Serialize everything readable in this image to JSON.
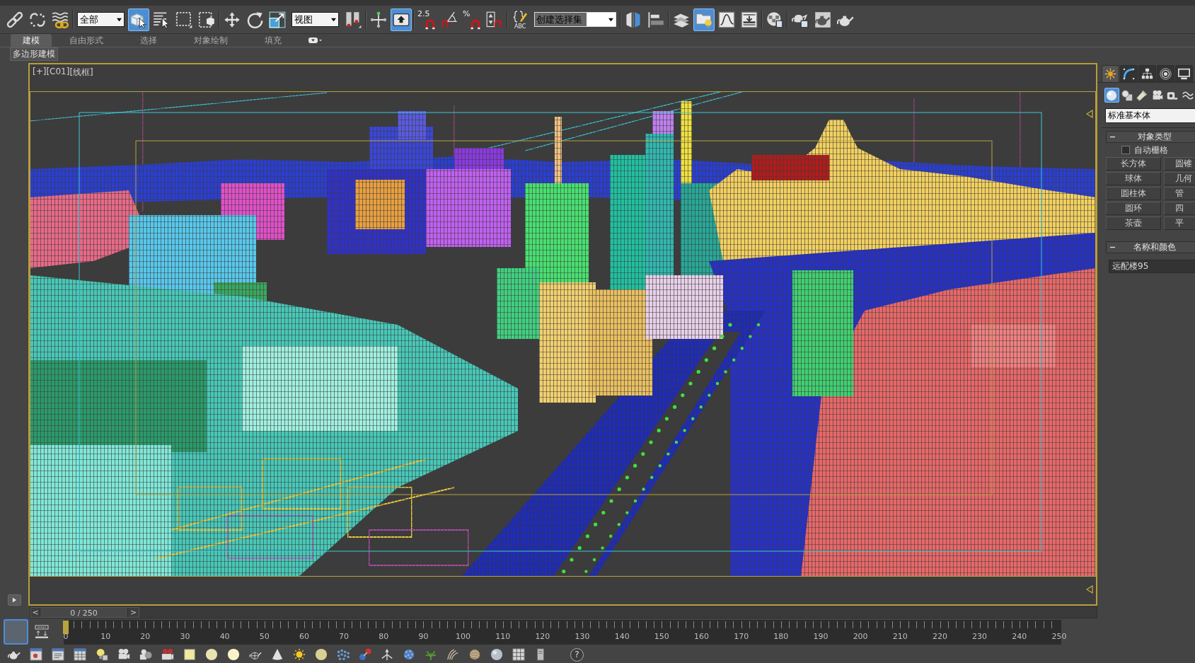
{
  "main_toolbar": [
    {
      "kind": "button",
      "active": false
    },
    {
      "kind": "button",
      "active": false
    },
    {
      "kind": "button",
      "active": false
    },
    {
      "kind": "separator"
    },
    {
      "kind": "dropdown",
      "value": "全部"
    },
    {
      "kind": "button",
      "active": true
    },
    {
      "kind": "button",
      "active": false
    },
    {
      "kind": "button",
      "active": false
    },
    {
      "kind": "button",
      "active": false
    },
    {
      "kind": "separator"
    },
    {
      "kind": "button",
      "active": false
    },
    {
      "kind": "button",
      "active": false
    },
    {
      "kind": "button",
      "active": false
    },
    {
      "kind": "dropdown",
      "value": "视图"
    },
    {
      "kind": "button",
      "active": false
    },
    {
      "kind": "separator"
    },
    {
      "kind": "button",
      "active": false
    },
    {
      "kind": "button",
      "active": true
    },
    {
      "kind": "separator"
    },
    {
      "kind": "snap",
      "label": "2.5",
      "active": false
    },
    {
      "kind": "button",
      "active": false
    },
    {
      "kind": "snap",
      "label": "%",
      "active": false
    },
    {
      "kind": "button",
      "active": false
    },
    {
      "kind": "separator"
    },
    {
      "kind": "captioned",
      "label": "ABC",
      "active": false
    },
    {
      "kind": "combo",
      "value": "创建选择集"
    },
    {
      "kind": "separator"
    },
    {
      "kind": "button",
      "active": false
    },
    {
      "kind": "button",
      "active": false
    },
    {
      "kind": "separator"
    },
    {
      "kind": "button",
      "active": false
    },
    {
      "kind": "button",
      "active": true
    },
    {
      "kind": "button",
      "active": false
    },
    {
      "kind": "button",
      "active": false
    },
    {
      "kind": "separator"
    },
    {
      "kind": "button",
      "active": false
    },
    {
      "kind": "separator"
    },
    {
      "kind": "button",
      "active": false
    },
    {
      "kind": "button",
      "active": false
    },
    {
      "kind": "button",
      "active": false
    }
  ],
  "ribbon": {
    "tabs": [
      {
        "label": "建模",
        "selected": true
      },
      {
        "label": "自由形式",
        "selected": false
      },
      {
        "label": "选择",
        "selected": false
      },
      {
        "label": "对象绘制",
        "selected": false
      },
      {
        "label": "填充",
        "selected": false
      }
    ],
    "panel": "多边形建模"
  },
  "viewport": {
    "active": true,
    "labels": [
      "[+]",
      "[C01]",
      "[线框]"
    ]
  },
  "command_panel": {
    "tabs": [
      {
        "selected": true
      },
      {
        "selected": false
      },
      {
        "selected": false
      },
      {
        "selected": false
      },
      {
        "selected": false
      }
    ],
    "categories": [
      {
        "selected": true
      },
      {
        "selected": false
      },
      {
        "selected": false
      },
      {
        "selected": false
      },
      {
        "selected": false
      },
      {
        "selected": false
      }
    ],
    "dropdown": "标准基本体",
    "rollouts": [
      {
        "kind": "object_type",
        "title": "对象类型",
        "expanded": true,
        "auto_grid": {
          "label": "自动栅格",
          "checked": false
        },
        "buttons": [
          "长方体",
          "圆锥",
          "球体",
          "几何",
          "圆柱体",
          "管",
          "圆环",
          "四",
          "茶壶",
          "平"
        ]
      },
      {
        "kind": "name_color",
        "title": "名称和颜色",
        "expanded": true,
        "name": "远配楼95"
      }
    ]
  },
  "time_slider": {
    "prev": "<",
    "label": "0 / 250",
    "next": ">",
    "level": 0
  },
  "track_bar": {
    "ticks": [
      "0",
      "10",
      "20",
      "30",
      "40",
      "50",
      "60",
      "70",
      "80",
      "90",
      "100",
      "110",
      "120",
      "130",
      "140",
      "150",
      "160",
      "170",
      "180",
      "190",
      "200",
      "210",
      "220",
      "230",
      "240",
      "250"
    ]
  },
  "bottom_toolbar": {
    "help_label": "?"
  }
}
